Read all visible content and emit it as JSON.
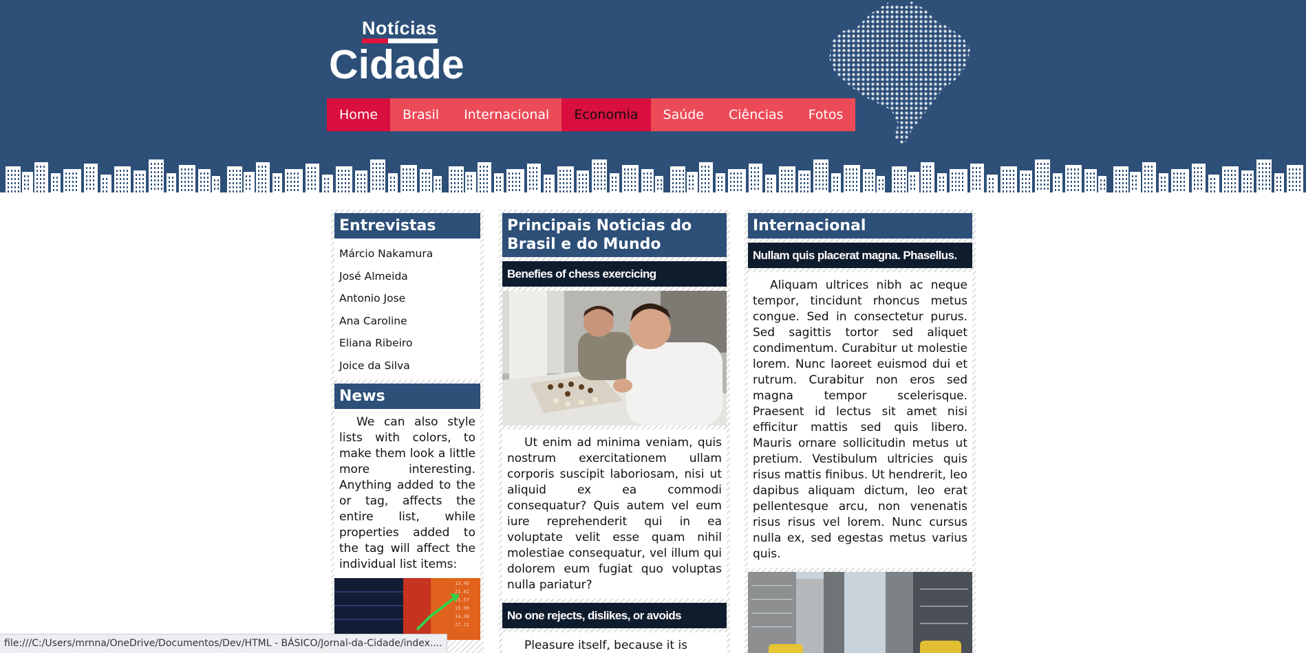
{
  "header": {
    "logo_top": "Notícias",
    "logo_main": "Cidade",
    "colors": {
      "background": "#2d4f78",
      "nav": "#ed4a57",
      "nav_active": "#d80f3f"
    }
  },
  "nav": {
    "items": [
      "Home",
      "Brasil",
      "Internacional",
      "Economia",
      "Saúde",
      "Ciências",
      "Fotos"
    ],
    "active": "Economia"
  },
  "left": {
    "entrevistas_title": "Entrevistas",
    "entrevistas": [
      "Márcio Nakamura",
      "José Almeida",
      "Antonio Jose",
      "Ana Caroline",
      "Eliana Ribeiro",
      "Joice da Silva"
    ],
    "news_title": "News",
    "news_text": "We can also style lists with colors, to make them look a little more interesting. Anything added to the or tag, affects the entire list, while properties added to the tag will affect the individual list items:"
  },
  "center": {
    "title": "Principais Noticias do Brasil e do Mundo",
    "article1_title": "Benefies of chess exercicing",
    "article1_text": "Ut enim ad minima veniam, quis nostrum exercitationem ullam corporis suscipit laboriosam, nisi ut aliquid ex ea commodi consequatur? Quis autem vel eum iure reprehenderit qui in ea voluptate velit esse quam nihil molestiae consequatur, vel illum qui dolorem eum fugiat quo voluptas nulla pariatur?",
    "article2_title": "No one rejects, dislikes, or avoids",
    "article2_text": "Pleasure itself, because it is"
  },
  "right": {
    "title": "Internacional",
    "article_title": "Nullam quis placerat magna. Phasellus.",
    "article_text": "Aliquam ultrices nibh ac neque tempor, tincidunt rhoncus metus congue. Sed in consectetur purus. Sed sagittis tortor sed aliquet condimentum. Curabitur ut molestie lorem. Nunc laoreet euismod dui et rutrum. Curabitur non eros sed magna tempor scelerisque. Praesent id lectus sit amet nisi efficitur mattis sed quis libero. Mauris ornare sollicitudin metus ut pretium. Vestibulum ultricies quis risus mattis finibus. Ut hendrerit, leo dapibus aliquam dictum, leo erat pellentesque arcu, non venenatis risus risus vel lorem. Nunc cursus nulla ex, sed egestas metus varius quis."
  },
  "status_bar": {
    "url": "file:///C:/Users/mrnna/OneDrive/Documentos/Dev/HTML - BÁSICO/Jornal-da-Cidade/index...."
  }
}
